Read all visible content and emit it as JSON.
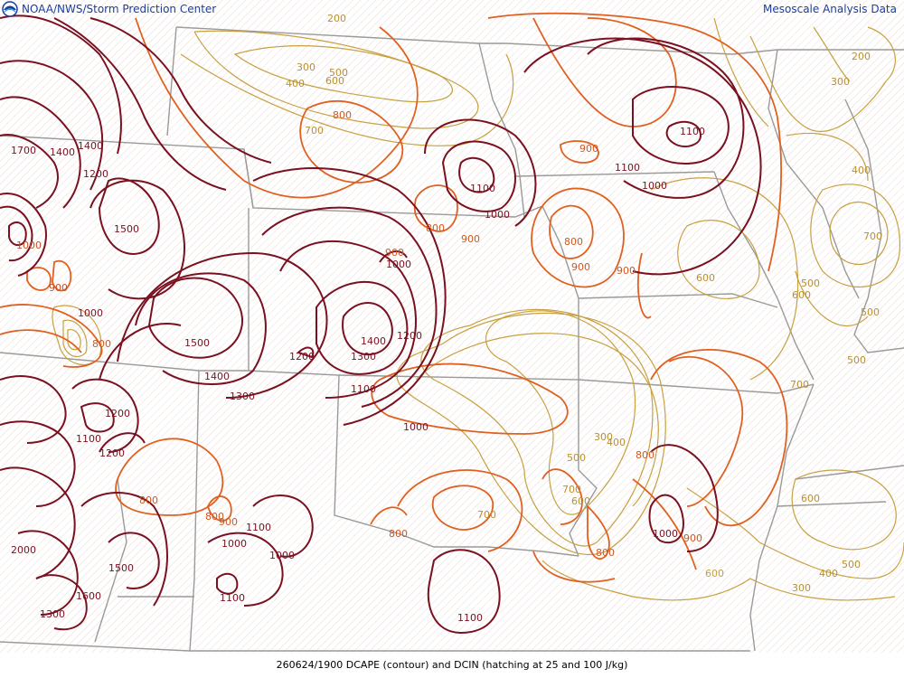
{
  "header": {
    "left_title": "NOAA/NWS/Storm Prediction Center",
    "right_title": "Mesoscale Analysis Data",
    "logo_icon": "noaa-logo-icon"
  },
  "footer": {
    "caption": "260624/1900 DCAPE (contour) and DCIN (hatching at 25 and 100 J/kg)"
  },
  "colors": {
    "boundary": "#a0a0a0",
    "dcape_low": "#c8a040",
    "dcape_mid": "#e06020",
    "dcape_high": "#7a1020",
    "hatch": "#e8d8d0"
  },
  "contour_labels": [
    {
      "text": "200"
    },
    {
      "text": "300"
    },
    {
      "text": "400"
    },
    {
      "text": "500"
    },
    {
      "text": "600"
    },
    {
      "text": "700"
    },
    {
      "text": "800"
    },
    {
      "text": "900"
    },
    {
      "text": "1000"
    },
    {
      "text": "1100"
    },
    {
      "text": "1200"
    },
    {
      "text": "1300"
    },
    {
      "text": "1400"
    },
    {
      "text": "1500"
    },
    {
      "text": "1600"
    },
    {
      "text": "1700"
    },
    {
      "text": "2000"
    }
  ]
}
